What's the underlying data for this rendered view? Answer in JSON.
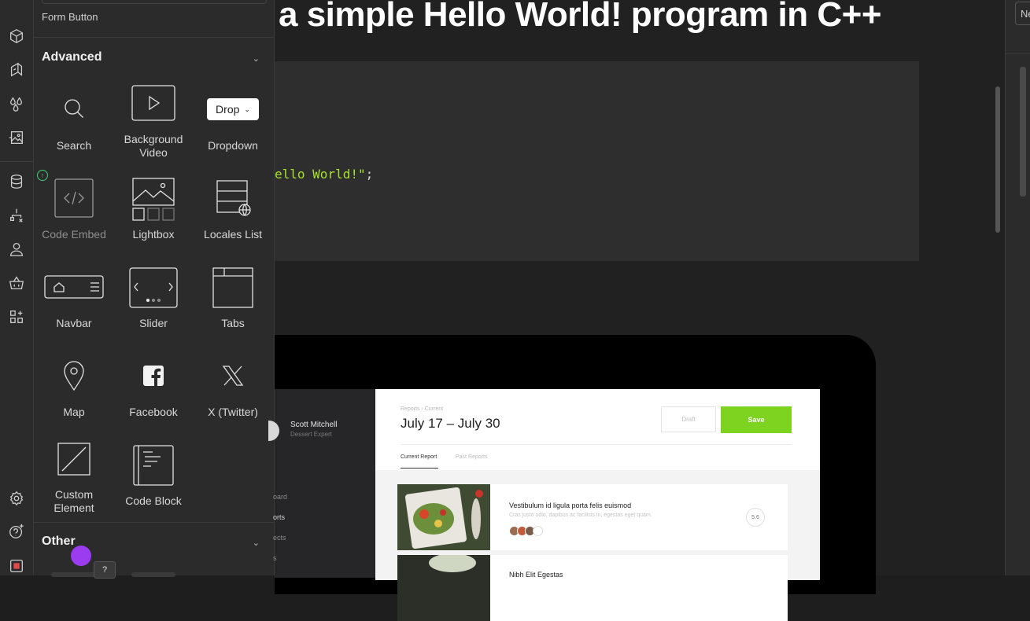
{
  "panel": {
    "form_button_label": "Form Button",
    "advanced": {
      "title": "Advanced",
      "items": [
        {
          "label": "Search"
        },
        {
          "label": "Background Video"
        },
        {
          "label": "Dropdown",
          "button_text": "Drop"
        },
        {
          "label": "Code Embed"
        },
        {
          "label": "Lightbox"
        },
        {
          "label": "Locales List"
        },
        {
          "label": "Navbar"
        },
        {
          "label": "Slider"
        },
        {
          "label": "Tabs"
        },
        {
          "label": "Map"
        },
        {
          "label": "Facebook"
        },
        {
          "label": "X (Twitter)"
        },
        {
          "label": "Custom Element"
        },
        {
          "label": "Code Block"
        }
      ]
    },
    "other": {
      "title": "Other"
    },
    "help_label": "?"
  },
  "canvas": {
    "heading": "a simple Hello World! program in C++",
    "code": {
      "fragment": "ello World!\"",
      "suffix": ";"
    },
    "dashboard": {
      "user_name": "Scott Mitchell",
      "user_role": "Dessert Expert",
      "nav": [
        "oard",
        "orts",
        "ects",
        "s"
      ],
      "breadcrumb": "Reports  ›  Current",
      "date_range": "July 17 – July 30",
      "draft_label": "Draft",
      "save_label": "Save",
      "tabs": [
        "Current Report",
        "Past Reports"
      ],
      "cards": [
        {
          "title": "Vestibulum id ligula porta felis euismod",
          "subtitle": "Cras justo odio, dapibus ac facilisis in, egestas eget quam.",
          "score": "5.6"
        },
        {
          "title": "Nibh Elit Egestas",
          "subtitle": "",
          "score": ""
        }
      ]
    }
  },
  "right_panel": {
    "input_value": "Ne"
  },
  "colors": {
    "accent_green": "#7ed321",
    "string_green": "#a6e22e",
    "cursor_purple": "#9b3cf0",
    "status_green": "#3fcf74",
    "stop_red": "#e04a4a"
  }
}
